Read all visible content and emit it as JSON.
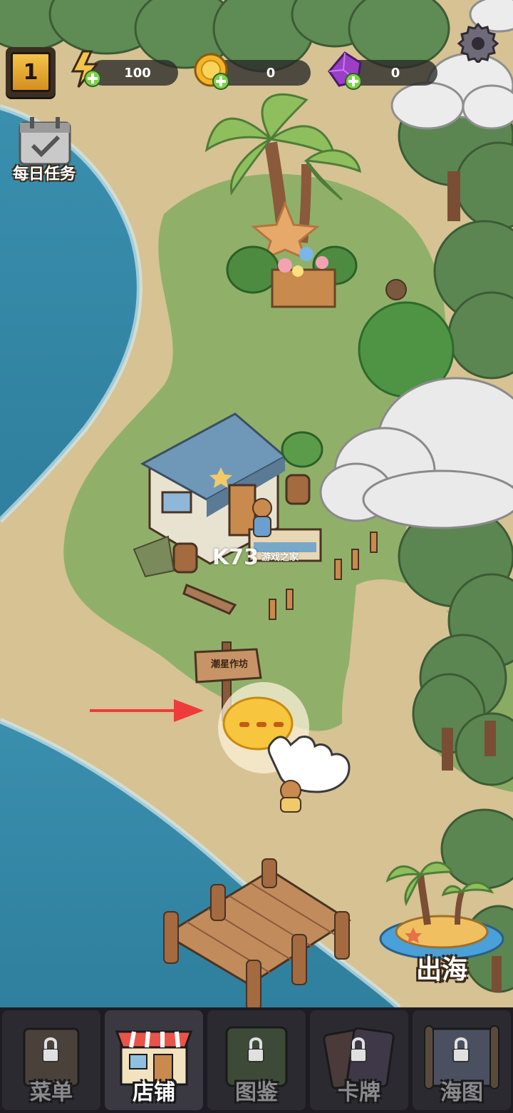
{
  "hud": {
    "level": "1",
    "energy": "100",
    "coins": "0",
    "gems": "0"
  },
  "daily_tasks": {
    "label": "每日任务"
  },
  "sign": {
    "text": "潮星作坊"
  },
  "watermark": {
    "brand": "K73",
    "sub": "游戏之家"
  },
  "sail": {
    "label": "出海"
  },
  "nav": {
    "items": [
      {
        "label": "菜单",
        "locked": true
      },
      {
        "label": "店铺",
        "locked": false
      },
      {
        "label": "图鉴",
        "locked": true
      },
      {
        "label": "卡牌",
        "locked": true
      },
      {
        "label": "海图",
        "locked": true
      }
    ]
  },
  "colors": {
    "sea": "#3f97b3",
    "sand": "#d9c59a",
    "grass": "#8fb06a",
    "forest": "#5d8a52",
    "accent": "#f4c34a"
  }
}
